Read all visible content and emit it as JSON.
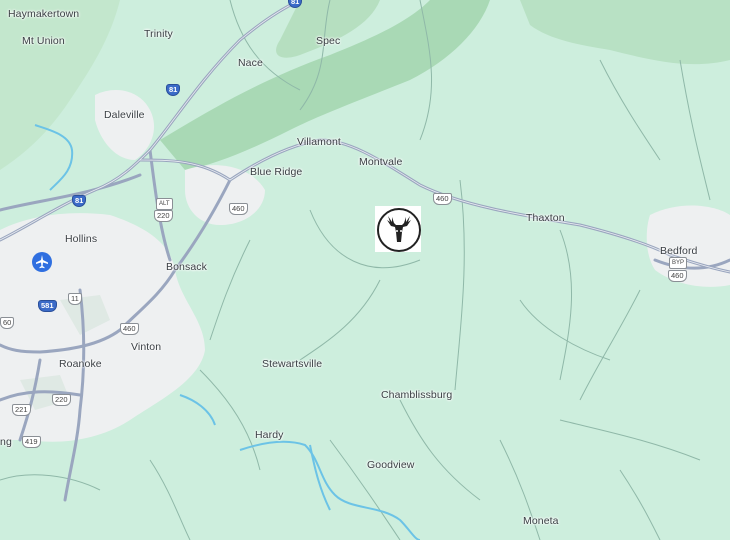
{
  "map": {
    "colors": {
      "land": "#cdeedd",
      "forest": "#a9d9b5",
      "urban": "#eef0f1",
      "road": "#9aa6bf",
      "water": "#6cc3e6",
      "airport": "#2f6fe0"
    },
    "places": {
      "haymakertown": "Haymakertown",
      "mt_union": "Mt Union",
      "trinity": "Trinity",
      "spec": "Spec",
      "nace": "Nace",
      "daleville": "Daleville",
      "villamont": "Villamont",
      "montvale": "Montvale",
      "blue_ridge": "Blue Ridge",
      "thaxton": "Thaxton",
      "bedford": "Bedford",
      "hollins": "Hollins",
      "bonsack": "Bonsack",
      "roanoke": "Roanoke",
      "vinton": "Vinton",
      "stewartsville": "Stewartsville",
      "chamblissburg": "Chamblissburg",
      "hardy": "Hardy",
      "goodview": "Goodview",
      "moneta": "Moneta",
      "edge_ng": "ng"
    },
    "shields": {
      "i81_top": "81",
      "i81_mid": "81",
      "alt220": "220",
      "alt_label": "ALT",
      "us460_br": "460",
      "us460_mv": "460",
      "us460_vinton": "460",
      "us460_left": "60",
      "us460_bedford": "460",
      "byp_label": "BYP",
      "us11": "11",
      "i581": "581",
      "us220": "220",
      "us221": "221",
      "us419": "419"
    },
    "marker_icon": "deer-head-icon",
    "airport_icon": "airplane-icon"
  }
}
